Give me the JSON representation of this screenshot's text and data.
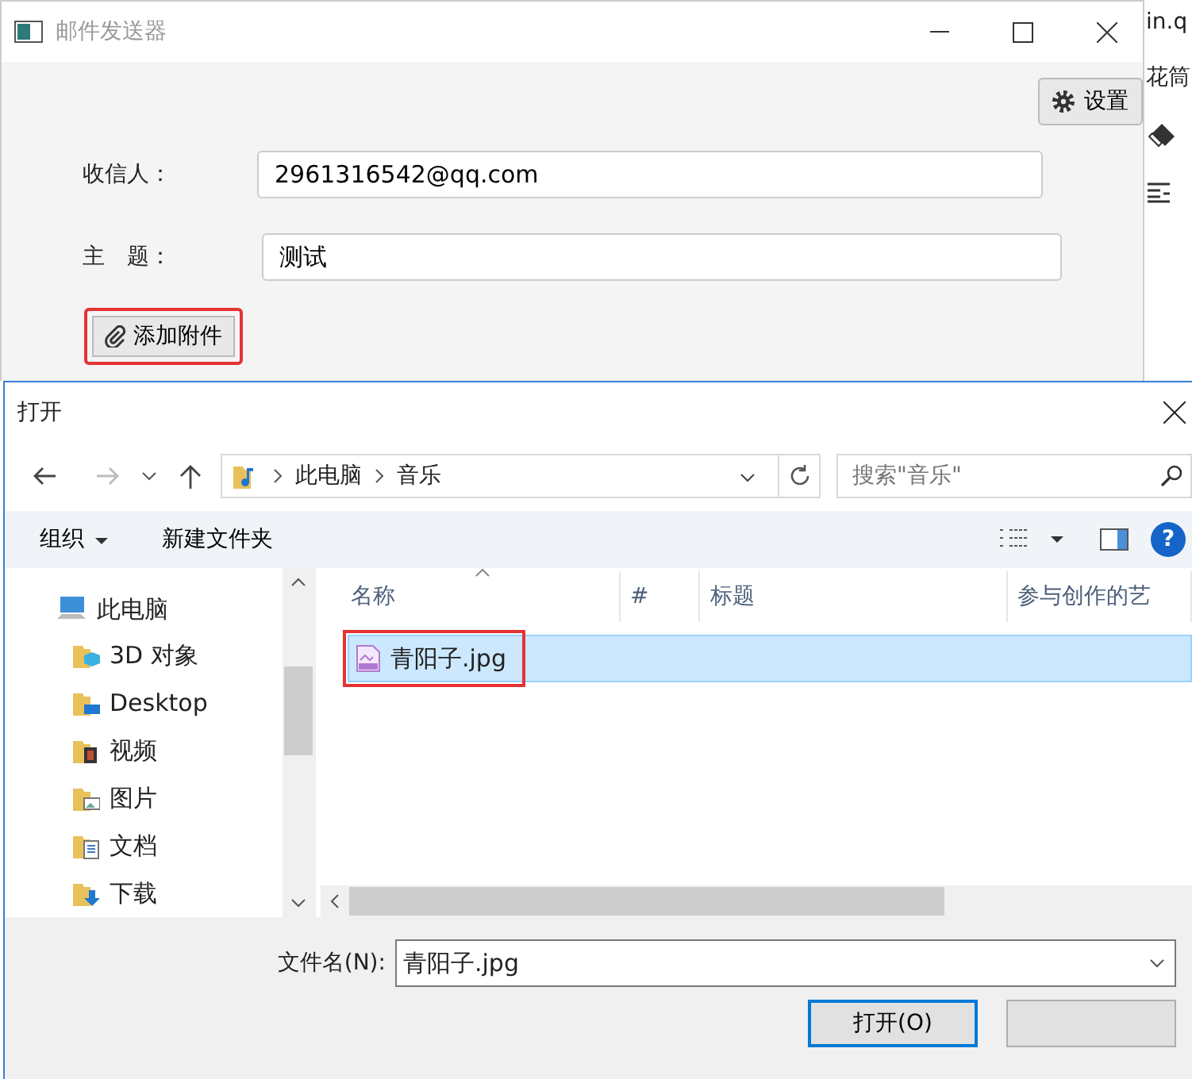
{
  "background_window": {
    "texts": [
      "in.q",
      "花筒"
    ]
  },
  "mail_window": {
    "title": "邮件发送器",
    "settings_button": "设置",
    "fields": [
      {
        "label": "收信人：",
        "value": "2961316542@qq.com"
      },
      {
        "label": "主　题：",
        "value": "测试"
      }
    ],
    "attach_button": {
      "label": "添加附件",
      "highlighted": true
    }
  },
  "open_dialog": {
    "title": "打开",
    "breadcrumb": [
      "此电脑",
      "音乐"
    ],
    "search": {
      "placeholder": "搜索\"音乐\""
    },
    "toolbar": {
      "organize": "组织",
      "new_folder": "新建文件夹",
      "help": "?"
    },
    "sidebar": {
      "items": [
        {
          "label": "此电脑",
          "kind": "computer",
          "children": [
            {
              "label": "3D 对象",
              "kind": "objects3d"
            },
            {
              "label": "Desktop",
              "kind": "desktop"
            },
            {
              "label": "视频",
              "kind": "videos"
            },
            {
              "label": "图片",
              "kind": "pictures"
            },
            {
              "label": "文档",
              "kind": "documents"
            },
            {
              "label": "下载",
              "kind": "downloads"
            }
          ]
        }
      ]
    },
    "table": {
      "columns": [
        "名称",
        "#",
        "标题",
        "参与创作的艺"
      ],
      "rows": [
        {
          "name": "青阳子.jpg",
          "selected": true,
          "highlighted": true
        }
      ]
    },
    "file_name": {
      "label": "文件名(N):",
      "value": "青阳子.jpg"
    },
    "buttons": [
      {
        "label": "打开(O)",
        "kind": "default"
      },
      {
        "kind": "plain"
      }
    ]
  }
}
